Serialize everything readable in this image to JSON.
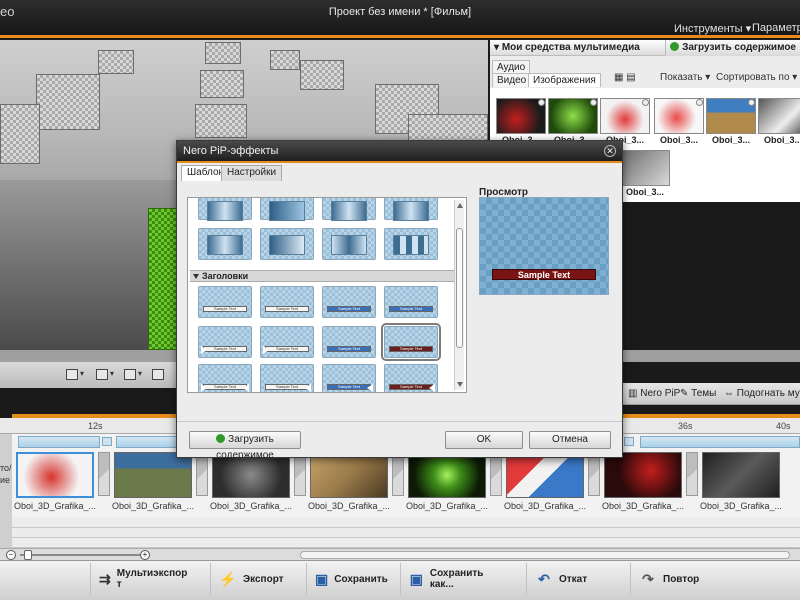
{
  "app": {
    "title_fragment": "eo",
    "window_title": "Проект без имени * [Фильм]"
  },
  "menu": {
    "tools": "Инструменты ▾",
    "params": "Параметры"
  },
  "media_panel": {
    "title": "Мои средства мультимедиа",
    "load_button": "Загрузить содержимое",
    "tabs": {
      "audio": "Аудио",
      "video": "Видео",
      "images": "Изображения"
    },
    "show_label": "Показать ▾",
    "sort_label": "Сортировать по ▾",
    "thumbnails": [
      {
        "label": "Oboi_3...",
        "color": "#c41e1e"
      },
      {
        "label": "Oboi_3...",
        "color": "#4caf1a"
      },
      {
        "label": "Oboi_3...",
        "color": "#e23a3a"
      },
      {
        "label": "Oboi_3...",
        "color": "#e84b4b"
      },
      {
        "label": "Oboi_3...",
        "color": "#3f7fbf"
      },
      {
        "label": "Oboi_3...",
        "color": "#555555"
      },
      {
        "label": "Oboi_3...",
        "color": "#6a6a6a"
      }
    ]
  },
  "right_toolbar": {
    "nero_pip": "Nero PiP",
    "themes": "Темы",
    "fit_music": "Подогнать музы"
  },
  "timeline": {
    "ruler_labels": [
      "12s",
      "36s",
      "40s"
    ],
    "side_label_lines": [
      "то/",
      "ие"
    ],
    "clips": [
      {
        "caption": "Oboi_3D_Grafika_...",
        "color": "#d7342e",
        "selected": true
      },
      {
        "caption": "Oboi_3D_Grafika_...",
        "color": "#6b7a4b",
        "selected": false
      },
      {
        "caption": "Oboi_3D_Grafika_...",
        "color": "#2d2d2d",
        "selected": false
      },
      {
        "caption": "Oboi_3D_Grafika_...",
        "color": "#9a7a4a",
        "selected": false
      },
      {
        "caption": "Oboi_3D_Grafika_...",
        "color": "#3f8f1a",
        "selected": false
      },
      {
        "caption": "Oboi_3D_Grafika_...",
        "color": "#3a78c8",
        "selected": false
      },
      {
        "caption": "Oboi_3D_Grafika_...",
        "color": "#2a0a0a",
        "selected": false
      },
      {
        "caption": "Oboi_3D_Grafika_...",
        "color": "#3c3c3c",
        "selected": false
      }
    ]
  },
  "bottom_bar": {
    "multiexport_line1": "Мультиэкспор",
    "multiexport_line2": "т",
    "export": "Экспорт",
    "save": "Сохранить",
    "save_as": "Сохранить как...",
    "undo": "Откат",
    "redo": "Повтор"
  },
  "dialog": {
    "title": "Nero PiP-эффекты",
    "tabs": {
      "template": "Шаблон",
      "settings": "Настройки"
    },
    "category_label": "Заголовки",
    "tile_text": "Sample Text",
    "preview_label": "Просмотр",
    "preview_text": "Sample Text",
    "load_button": "Загрузить содержимое",
    "ok": "OK",
    "cancel": "Отмена"
  }
}
